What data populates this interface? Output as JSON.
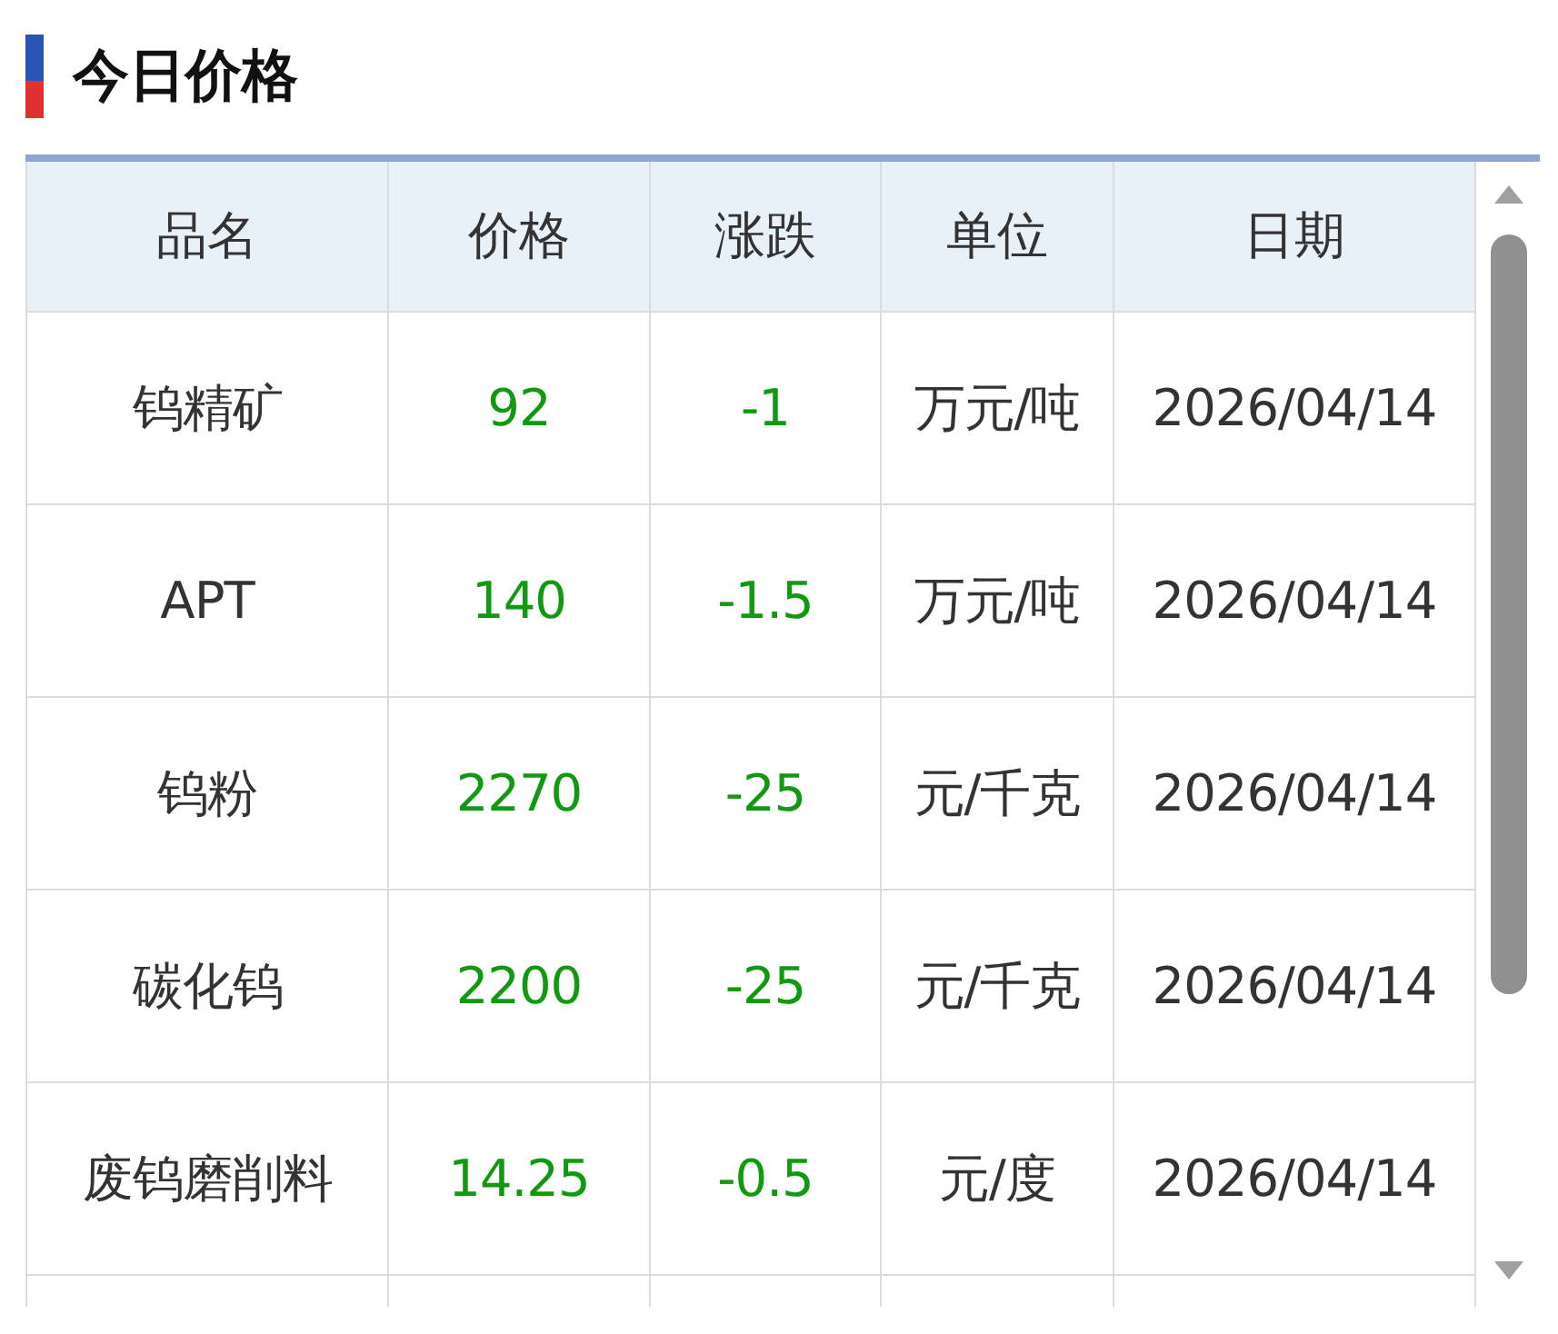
{
  "title": "今日价格",
  "table": {
    "columns": [
      "品名",
      "价格",
      "涨跌",
      "单位",
      "日期"
    ],
    "rows": [
      [
        "钨精矿",
        "92",
        "-1",
        "万元/吨",
        "2026/04/14"
      ],
      [
        "APT",
        "140",
        "-1.5",
        "万元/吨",
        "2026/04/14"
      ],
      [
        "钨粉",
        "2270",
        "-25",
        "元/千克",
        "2026/04/14"
      ],
      [
        "碳化钨",
        "2200",
        "-25",
        "元/千克",
        "2026/04/14"
      ],
      [
        "废钨磨削料",
        "14.25",
        "-0.5",
        "元/度",
        "2026/04/14"
      ]
    ]
  }
}
